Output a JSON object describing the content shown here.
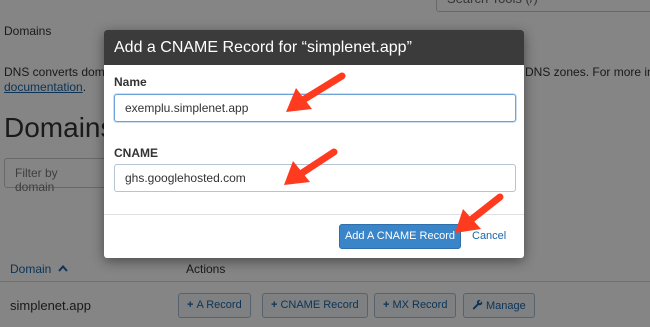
{
  "background": {
    "search_tools_label": "Search Tools (/)",
    "breadcrumb": "Domains",
    "description_start": "DNS converts dom",
    "description_link": "documentation",
    "description_link_suffix": ".",
    "description_right": "DNS zones. For more in",
    "page_title": "Domains",
    "filter_placeholder": "Filter by domain",
    "table": {
      "col_domain": "Domain",
      "col_domain_sort_icon": "caret-up-icon",
      "col_actions": "Actions",
      "rows": [
        {
          "domain": "simplenet.app",
          "actions": [
            "A Record",
            "CNAME Record",
            "MX Record",
            "Manage"
          ]
        }
      ]
    }
  },
  "modal": {
    "title": "Add a CNAME Record for “simplenet.app”",
    "name_label": "Name",
    "name_value": "exemplu.simplenet.app",
    "cname_label": "CNAME",
    "cname_value": "ghs.googlehosted.com",
    "submit_label": "Add A CNAME Record",
    "cancel_label": "Cancel"
  },
  "colors": {
    "annotation_arrow": "#ff3b1f",
    "primary_button": "#3a85c8",
    "modal_header": "#3b3b3b",
    "link": "#1a65a8"
  }
}
